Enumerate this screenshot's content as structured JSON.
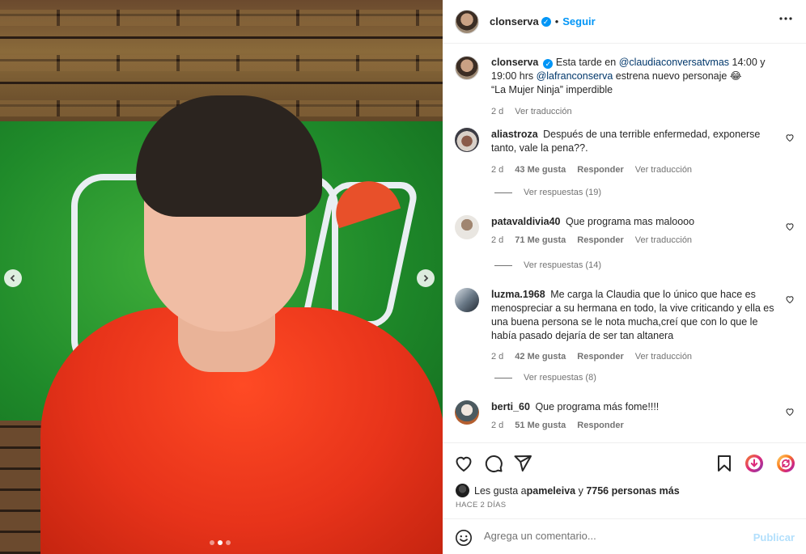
{
  "post": {
    "carousel_total": 3,
    "carousel_active": 2
  },
  "header": {
    "username": "clonserva",
    "dot": "•",
    "follow_label": "Seguir",
    "more_label": "•••"
  },
  "caption": {
    "username": "clonserva",
    "text_1": "Esta tarde en ",
    "mention_1": "@claudiaconversatvmas",
    "text_2": " 14:00 y 19:00 hrs ",
    "mention_2": "@lafranconserva",
    "text_3": " estrena nuevo personaje 😂",
    "text_4": "“La Mujer Ninja” imperdible",
    "time": "2 d",
    "translate": "Ver traducción"
  },
  "comments": [
    {
      "username": "aliastroza",
      "text": "Después de una terrible enfermedad, exponerse tanto, vale la pena??.",
      "time": "2 d",
      "likes": "43 Me gusta",
      "reply": "Responder",
      "translate": "Ver traducción",
      "replies": "Ver respuestas (19)"
    },
    {
      "username": "patavaldivia40",
      "text": "Que programa mas maloooo",
      "time": "2 d",
      "likes": "71 Me gusta",
      "reply": "Responder",
      "translate": "Ver traducción",
      "replies": "Ver respuestas (14)"
    },
    {
      "username": "luzma.1968",
      "text": "Me carga la Claudia que lo único que hace es menospreciar a su hermana en todo, la vive criticando y ella es una buena persona se le nota mucha,creí que con lo que le había pasado dejaría de ser tan altanera",
      "time": "2 d",
      "likes": "42 Me gusta",
      "reply": "Responder",
      "translate": "Ver traducción",
      "replies": "Ver respuestas (8)"
    },
    {
      "username": "berti_60",
      "text": "Que programa más fome!!!!",
      "time": "2 d",
      "likes": "51 Me gusta",
      "reply": "Responder"
    }
  ],
  "likes": {
    "prefix": "Les gusta a ",
    "user": "pameleiva",
    "middle": " y ",
    "count": "7756 personas más"
  },
  "date": "HACE 2 DÍAS",
  "composer": {
    "placeholder": "Agrega un comentario...",
    "publish_label": "Publicar"
  },
  "colors": {
    "accent": "#0095f6",
    "mention": "#00376b",
    "publish_disabled": "#b2dffc"
  }
}
